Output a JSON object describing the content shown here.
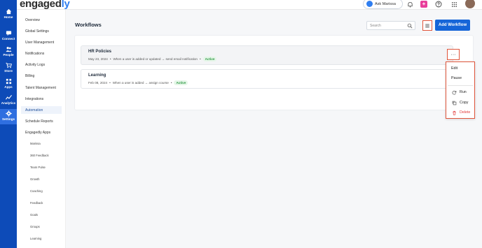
{
  "header": {
    "logo_main": "engaged",
    "logo_accent": "ly",
    "ask_label": "Ask Marissa",
    "plus_label": "+"
  },
  "rail": {
    "items": [
      {
        "label": "Home",
        "icon": "home-icon"
      },
      {
        "label": "Connect",
        "icon": "chat-icon"
      },
      {
        "label": "People",
        "icon": "people-icon"
      },
      {
        "label": "Store",
        "icon": "cart-icon"
      },
      {
        "label": "Apps",
        "icon": "apps-icon"
      },
      {
        "label": "Analytics",
        "icon": "analytics-icon"
      },
      {
        "label": "Settings",
        "icon": "gear-icon"
      }
    ]
  },
  "subnav": {
    "items": [
      {
        "label": "Overview"
      },
      {
        "label": "Global Settings"
      },
      {
        "label": "User Management"
      },
      {
        "label": "Notifications"
      },
      {
        "label": "Activity Logs"
      },
      {
        "label": "Billing"
      },
      {
        "label": "Talent Management"
      },
      {
        "label": "Integrations"
      },
      {
        "label": "Automation"
      },
      {
        "label": "Schedule Reports"
      },
      {
        "label": "Engagedly Apps"
      }
    ],
    "apps": [
      {
        "label": "Marissa"
      },
      {
        "label": "360 Feedback"
      },
      {
        "label": "Team Pulse"
      },
      {
        "label": "Growth"
      },
      {
        "label": "Coaching"
      },
      {
        "label": "Feedback"
      },
      {
        "label": "Goals"
      },
      {
        "label": "Groups"
      },
      {
        "label": "Learning"
      }
    ]
  },
  "main": {
    "title": "Workflows",
    "search_placeholder": "Search",
    "add_label": "Add Workflow",
    "more_label": "···"
  },
  "workflows": [
    {
      "name": "HR Policies",
      "date": "May 23, 2024",
      "description": "When a user is added or updated → send email notification",
      "status": "Active"
    },
    {
      "name": "Learning",
      "date": "Feb 08, 2024",
      "description": "When a user is added → assign course",
      "status": "Active"
    }
  ],
  "menu": {
    "edit": "Edit",
    "pause": "Pause",
    "run": "Run",
    "copy": "Copy",
    "delete": "Delete"
  },
  "colors": {
    "rail": "#0d4bb8",
    "primary": "#1565d8",
    "highlight": "#e0553b",
    "active_badge": "#2f9a45",
    "danger": "#e23b3b"
  }
}
